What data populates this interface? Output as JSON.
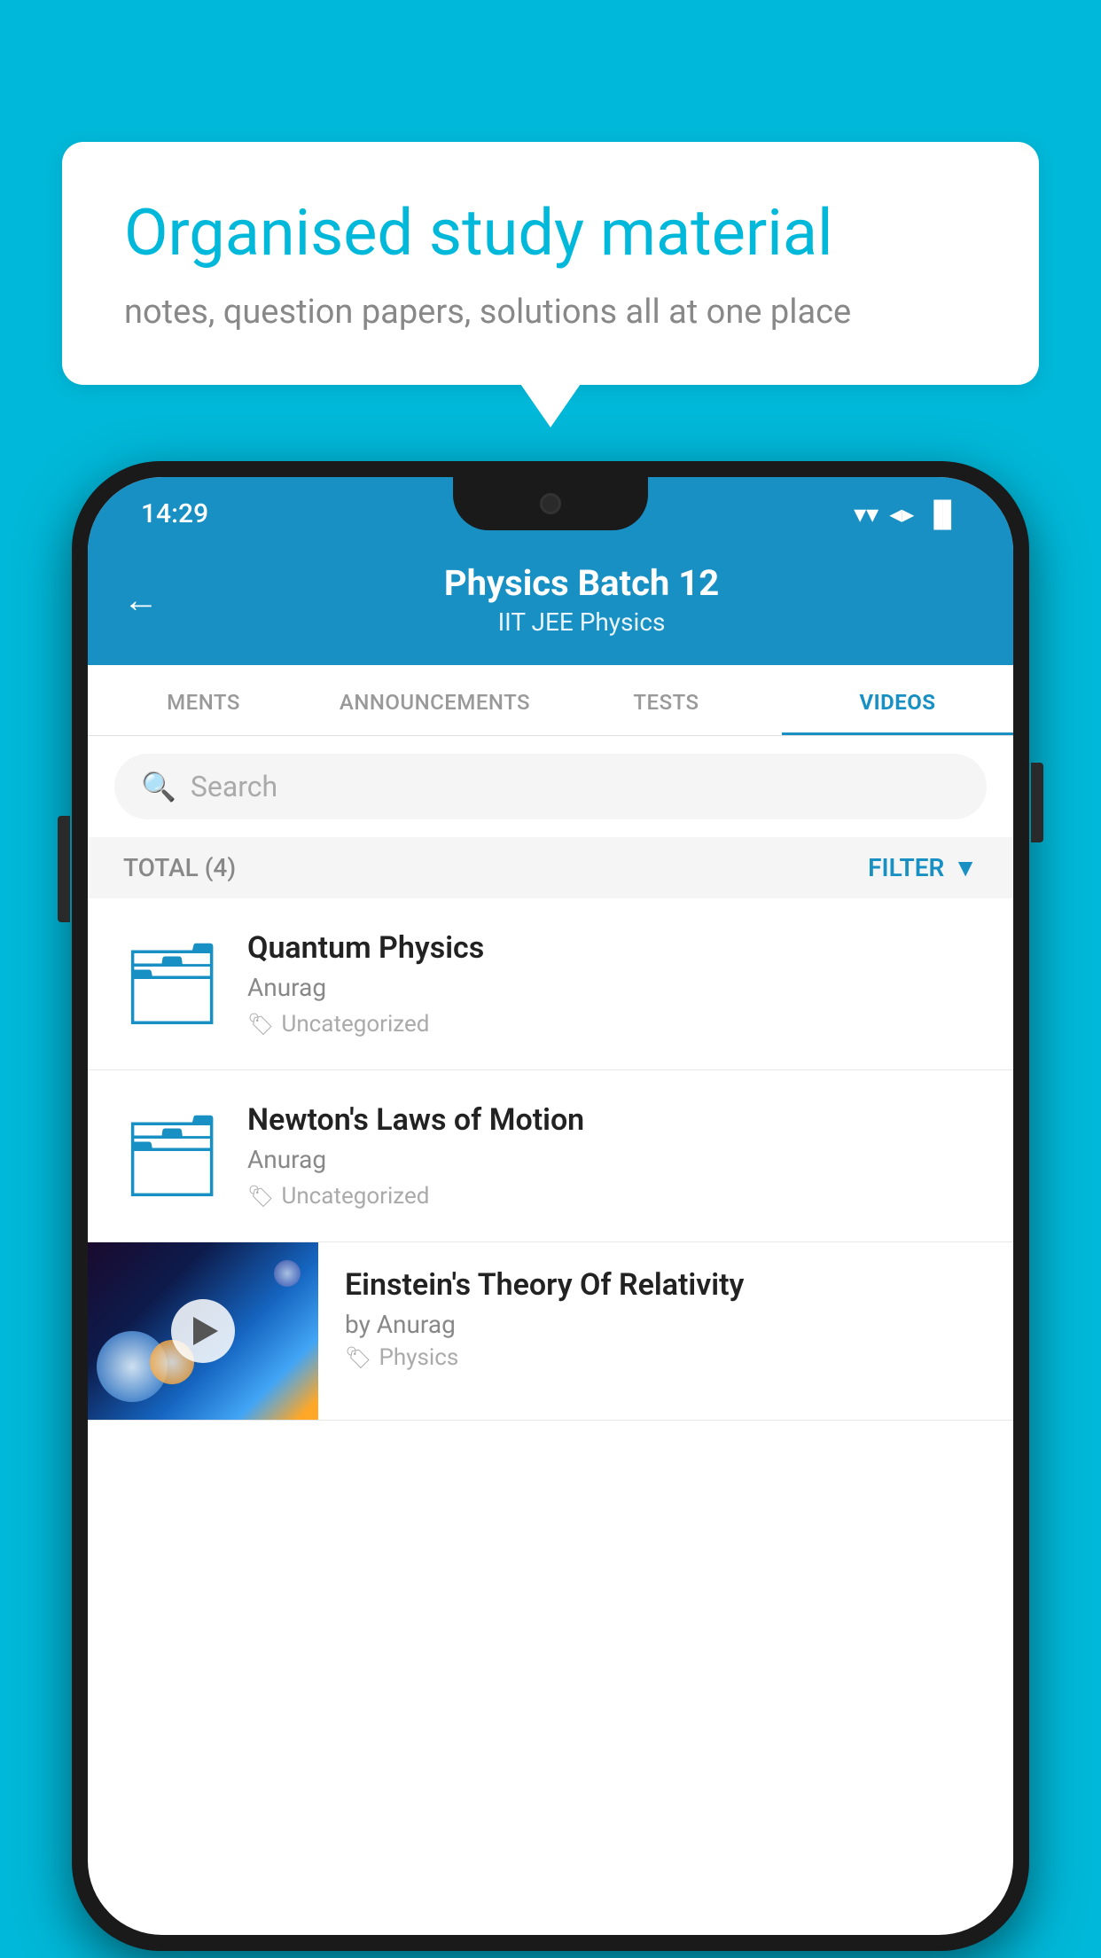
{
  "background_color": "#00B8D9",
  "speech_bubble": {
    "title": "Organised study material",
    "subtitle": "notes, question papers, solutions all at one place"
  },
  "status_bar": {
    "time": "14:29",
    "wifi": "▼",
    "signal": "▲",
    "battery": "▐"
  },
  "app_header": {
    "back_label": "←",
    "title": "Physics Batch 12",
    "subtitle": "IIT JEE   Physics"
  },
  "tabs": [
    {
      "label": "MENTS",
      "active": false
    },
    {
      "label": "ANNOUNCEMENTS",
      "active": false
    },
    {
      "label": "TESTS",
      "active": false
    },
    {
      "label": "VIDEOS",
      "active": true
    }
  ],
  "search": {
    "placeholder": "Search"
  },
  "filter": {
    "total_label": "TOTAL (4)",
    "filter_label": "FILTER"
  },
  "videos": [
    {
      "id": 1,
      "title": "Quantum Physics",
      "author": "Anurag",
      "tag": "Uncategorized",
      "type": "folder"
    },
    {
      "id": 2,
      "title": "Newton's Laws of Motion",
      "author": "Anurag",
      "tag": "Uncategorized",
      "type": "folder"
    },
    {
      "id": 3,
      "title": "Einstein's Theory Of Relativity",
      "author": "by Anurag",
      "tag": "Physics",
      "type": "video"
    }
  ]
}
